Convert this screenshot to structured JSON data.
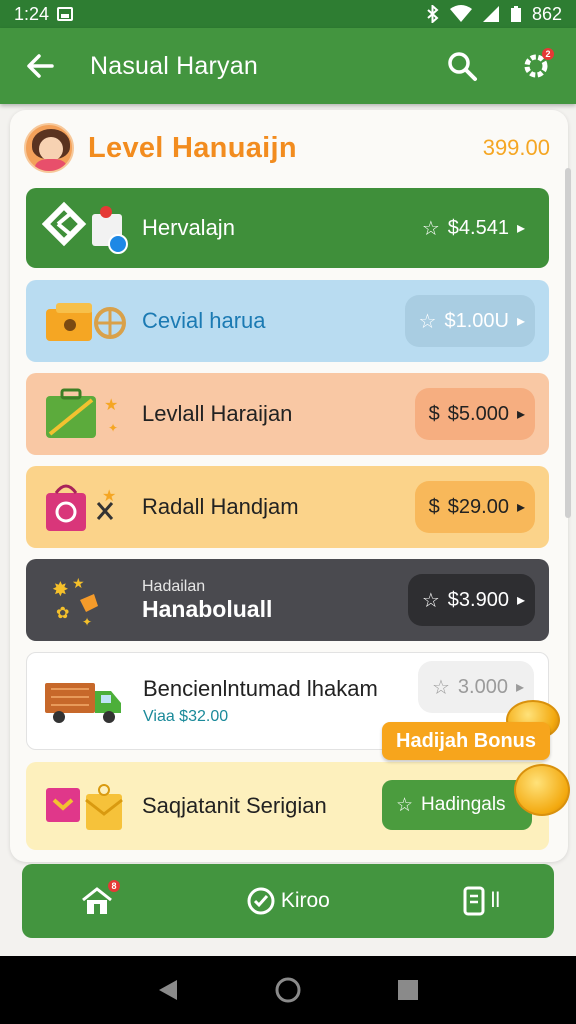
{
  "status_bar": {
    "time": "1:24",
    "battery": "862"
  },
  "app_bar": {
    "title": "Nasual Haryan"
  },
  "level": {
    "title": "Level Hanuaijn",
    "amount": "399.00"
  },
  "rows": [
    {
      "label": "Hervalajn",
      "amount": "$4.541"
    },
    {
      "label": "Cevial harua",
      "amount": "$1.00U"
    },
    {
      "label": "Levlall Haraijan",
      "amount": "$5.000"
    },
    {
      "label": "Radall Handjam",
      "amount": "$29.00"
    },
    {
      "small": "Hadailan",
      "label": "Hanaboluall",
      "amount": "$3.900"
    },
    {
      "label": "Bencienlntumad lhakam",
      "sub": "Viaa $32.00",
      "amount": "3.000"
    },
    {
      "label": "Saqjatanit Serigian",
      "amount": "Hadingals"
    }
  ],
  "bonus": {
    "label": "Hadijah Bonus"
  },
  "bottom_nav": {
    "center_label": "Kiroo",
    "right_label": "ll"
  },
  "colors": {
    "primary": "#43953f",
    "accent": "#f28c1f",
    "bonus": "#f7a51c"
  }
}
